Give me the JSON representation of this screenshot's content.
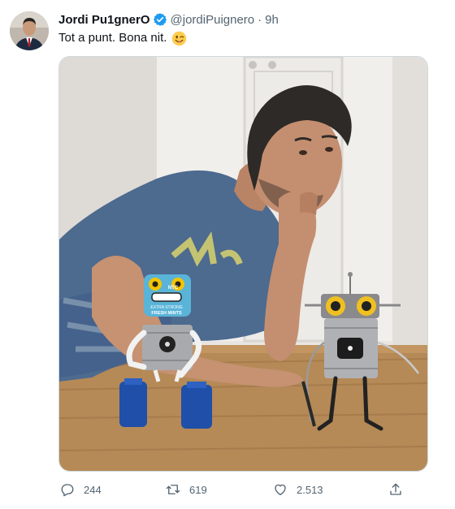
{
  "tweet": {
    "display_name": "Jordi Pu1gnerO",
    "handle": "@jordiPuignero",
    "separator": "·",
    "time": "9h",
    "text": "Tot a punt. Bona nit.",
    "emoji": "winking-face",
    "verified": true
  },
  "media": {
    "sticker_lines": [
      "NTC",
      "EXTRA STRONG",
      "FRESH MINTS"
    ]
  },
  "actions": {
    "reply_count": "244",
    "retweet_count": "619",
    "like_count": "2.513"
  },
  "colors": {
    "text": "#0f1419",
    "secondary": "#536471",
    "verified": "#1d9bf0",
    "border": "#cfd9de"
  }
}
